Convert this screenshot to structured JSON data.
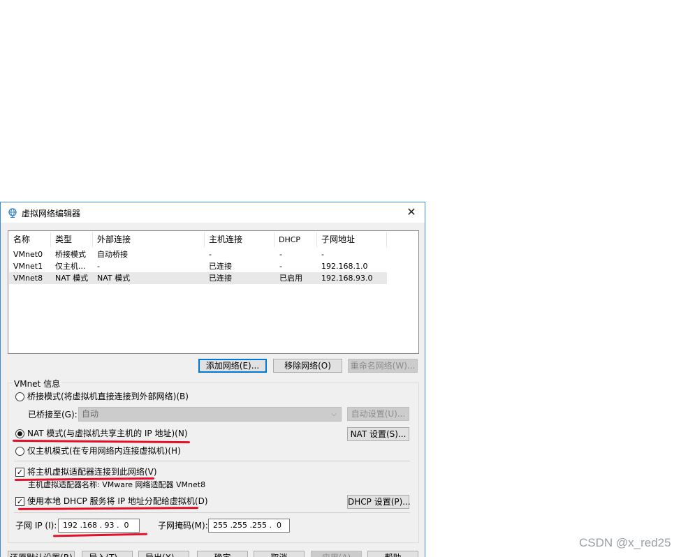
{
  "window": {
    "title": "虚拟网络编辑器",
    "close_symbol": "✕"
  },
  "table": {
    "columns": [
      "名称",
      "类型",
      "外部连接",
      "主机连接",
      "DHCP",
      "子网地址"
    ],
    "rows": [
      [
        "VMnet0",
        "桥接模式",
        "自动桥接",
        "-",
        "-",
        "-"
      ],
      [
        "VMnet1",
        "仅主机...",
        "-",
        "已连接",
        "-",
        "192.168.1.0"
      ],
      [
        "VMnet8",
        "NAT 模式",
        "NAT 模式",
        "已连接",
        "已启用",
        "192.168.93.0"
      ]
    ],
    "selected_row": "VMnet8"
  },
  "list_buttons": {
    "add": "添加网络(E)...",
    "remove": "移除网络(O)",
    "rename": "重命名网络(W)..."
  },
  "vmnet_info": {
    "group_label": "VMnet 信息",
    "bridged_label": "桥接模式(将虚拟机直接连接到外部网络)(B)",
    "bridged_to_label": "已桥接至(G):",
    "bridged_to_value": "自动",
    "auto_settings": "自动设置(U)...",
    "nat_label": "NAT 模式(与虚拟机共享主机的 IP 地址)(N)",
    "nat_settings": "NAT 设置(S)...",
    "hostonly_label": "仅主机模式(在专用网络内连接虚拟机)(H)",
    "selected_mode": "nat",
    "connect_adapter_label": "将主机虚拟适配器连接到此网络(V)",
    "connect_adapter_checked": true,
    "adapter_name_label": "主机虚拟适配器名称: VMware 网络适配器 VMnet8",
    "dhcp_label": "使用本地 DHCP 服务将 IP 地址分配给虚拟机(D)",
    "dhcp_checked": true,
    "dhcp_settings": "DHCP 设置(P)...",
    "subnet_ip_label": "子网 IP (I):",
    "subnet_ip_value": "192 .168 . 93 .  0",
    "subnet_mask_label": "子网掩码(M):",
    "subnet_mask_value": "255 .255 .255 .  0"
  },
  "bottom_buttons": {
    "restore": "还原默认设置(R)",
    "import": "导入(T)...",
    "export": "导出(X)...",
    "ok": "确定",
    "cancel": "取消",
    "apply": "应用(A)",
    "help": "帮助"
  },
  "watermark": "CSDN @x_red25",
  "annotation_color": "#e3102a"
}
